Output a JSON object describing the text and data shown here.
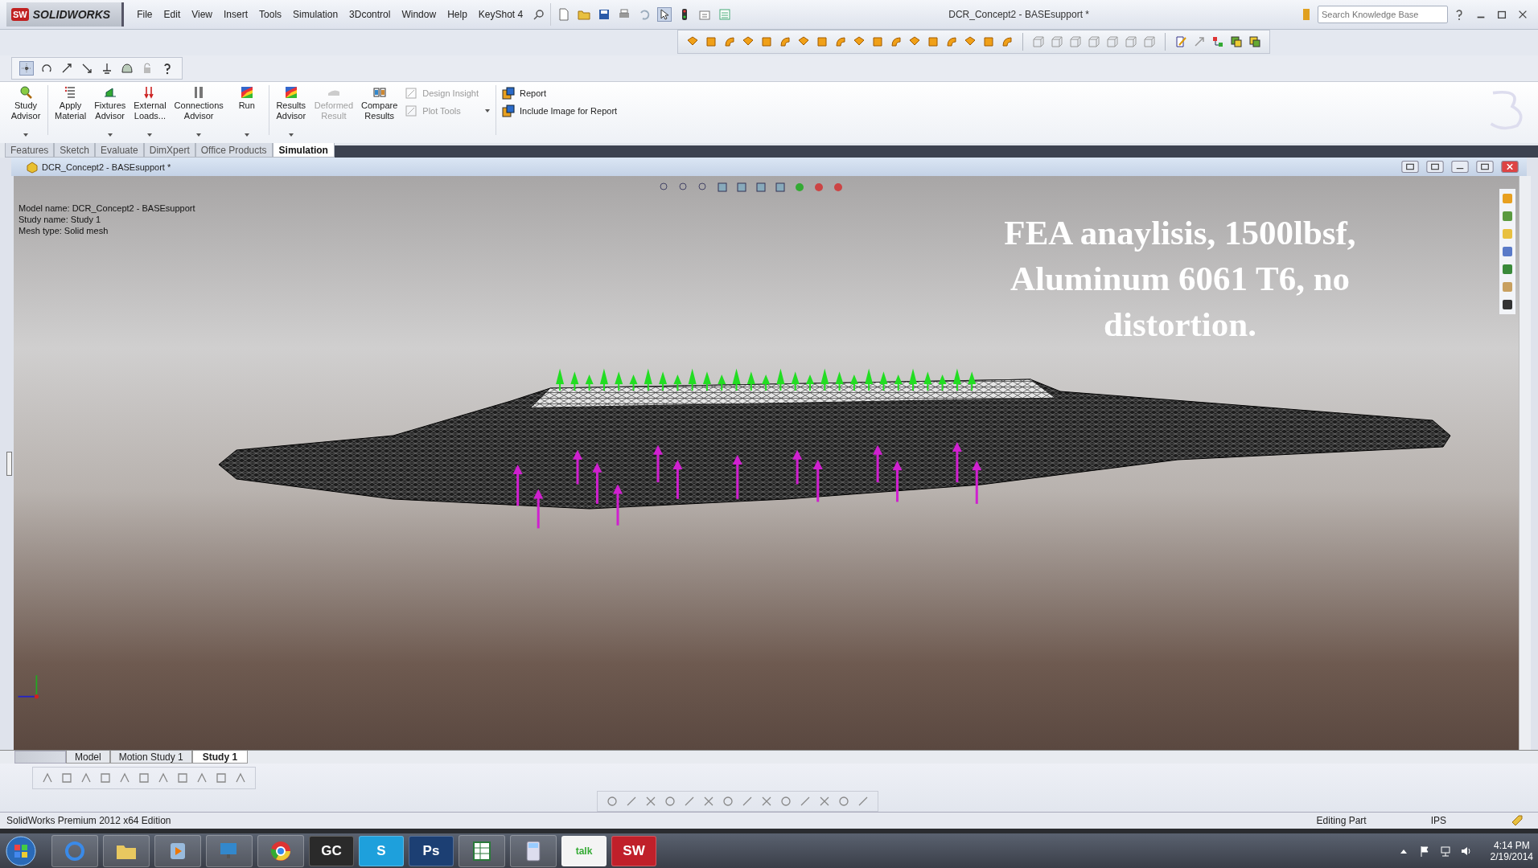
{
  "app_logo": {
    "badge": "SW",
    "name": "SOLIDWORKS"
  },
  "menu": [
    "File",
    "Edit",
    "View",
    "Insert",
    "Tools",
    "Simulation",
    "3Dcontrol",
    "Window",
    "Help",
    "KeyShot 4"
  ],
  "window": {
    "title": "DCR_Concept2 - BASEsupport *"
  },
  "search": {
    "placeholder": "Search Knowledge Base"
  },
  "commands": [
    {
      "label": "Study Advisor",
      "disabled": false,
      "dropdown": true
    },
    {
      "label": "Apply Material",
      "disabled": false,
      "dropdown": false
    },
    {
      "label": "Fixtures Advisor",
      "disabled": false,
      "dropdown": true
    },
    {
      "label": "External Loads...",
      "disabled": false,
      "dropdown": true
    },
    {
      "label": "Connections Advisor",
      "disabled": false,
      "dropdown": true
    },
    {
      "label": "Run",
      "disabled": false,
      "dropdown": true
    },
    {
      "label": "Results Advisor",
      "disabled": false,
      "dropdown": true
    },
    {
      "label": "Deformed Result",
      "disabled": true,
      "dropdown": false
    },
    {
      "label": "Compare Results",
      "disabled": false,
      "dropdown": false
    }
  ],
  "side_commands": [
    {
      "label": "Design Insight",
      "disabled": true
    },
    {
      "label": "Plot Tools",
      "disabled": true
    }
  ],
  "report_commands": [
    {
      "label": "Report",
      "disabled": false
    },
    {
      "label": "Include Image for Report",
      "disabled": false
    }
  ],
  "tabs": [
    {
      "label": "Features",
      "selected": false
    },
    {
      "label": "Sketch",
      "selected": false
    },
    {
      "label": "Evaluate",
      "selected": false
    },
    {
      "label": "DimXpert",
      "selected": false
    },
    {
      "label": "Office Products",
      "selected": false
    },
    {
      "label": "Simulation",
      "selected": true
    }
  ],
  "document": {
    "title": "DCR_Concept2 - BASEsupport *"
  },
  "model_info": [
    "Model name: DCR_Concept2 - BASEsupport",
    "Study name: Study 1",
    "Mesh type: Solid mesh"
  ],
  "annotation": "FEA anaylisis, 1500lbsf, Aluminum 6061 T6, no distortion.",
  "bottom_tabs": [
    {
      "label": "Model",
      "selected": false
    },
    {
      "label": "Motion Study 1",
      "selected": false
    },
    {
      "label": "Study 1",
      "selected": true
    }
  ],
  "status_bar": {
    "edition": "SolidWorks Premium 2012 x64 Edition",
    "mode": "Editing Part",
    "units": "IPS"
  },
  "taskbar": {
    "apps": [
      {
        "kind": "start"
      },
      {
        "kind": "globe"
      },
      {
        "kind": "folder"
      },
      {
        "kind": "media"
      },
      {
        "kind": "monitor"
      },
      {
        "kind": "chrome"
      },
      {
        "kind": "tile",
        "glyph": "GC",
        "color": "#2a2a2a"
      },
      {
        "kind": "tile",
        "glyph": "S",
        "color": "#1ea0dc"
      },
      {
        "kind": "tile",
        "glyph": "Ps",
        "color": "#1c3f73"
      },
      {
        "kind": "sheet"
      },
      {
        "kind": "calc"
      },
      {
        "kind": "bubble",
        "glyph": "talk"
      },
      {
        "kind": "tile",
        "glyph": "SW",
        "color": "#c0202a"
      }
    ],
    "time": "4:14 PM",
    "date": "2/19/2014"
  }
}
